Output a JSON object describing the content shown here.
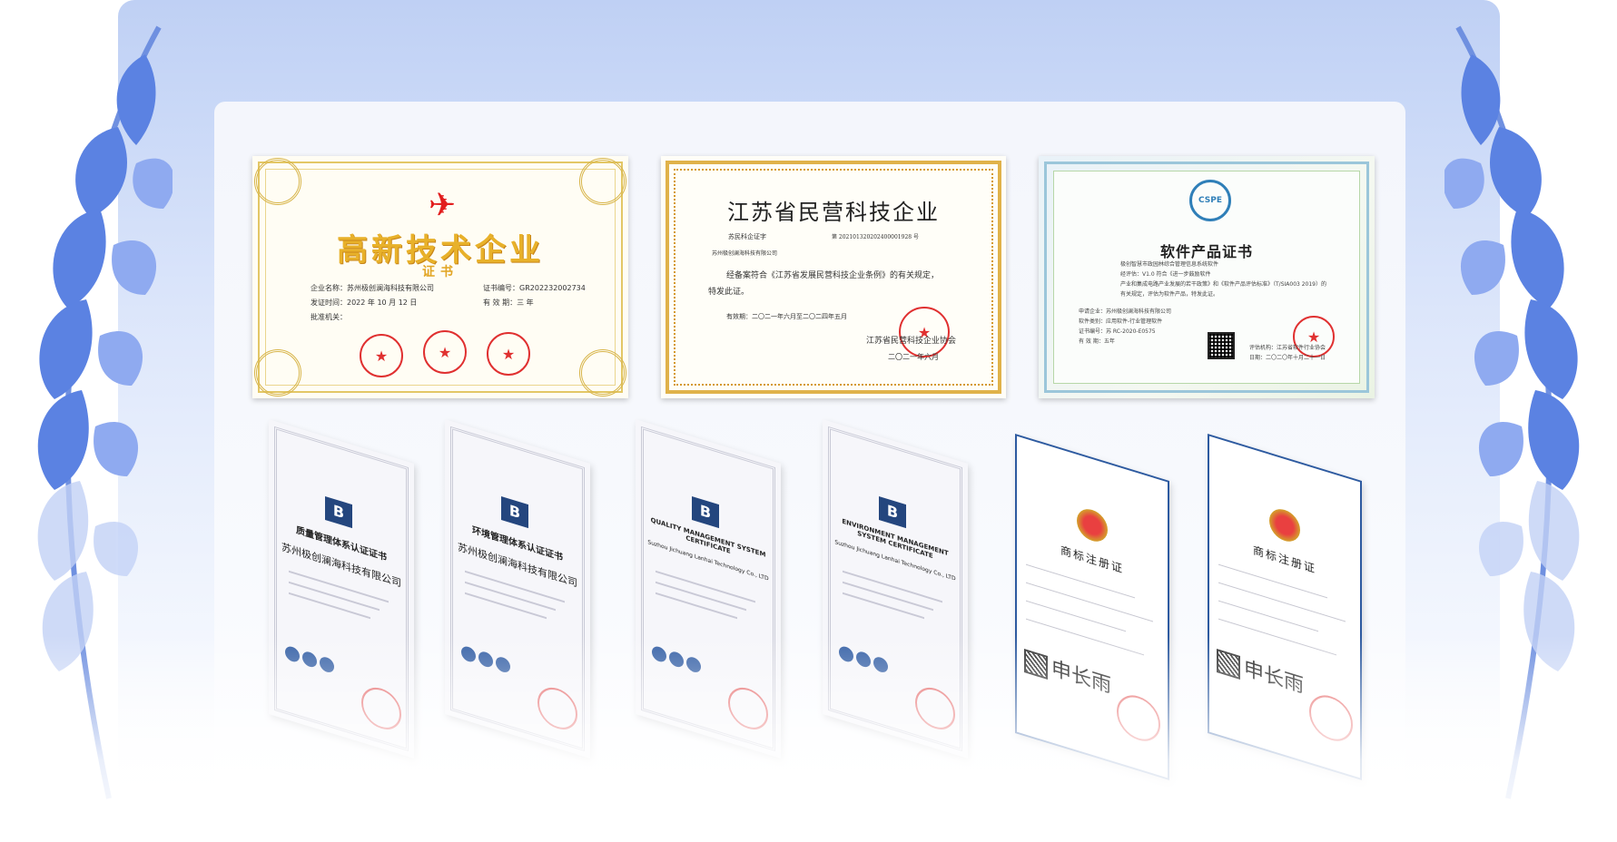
{
  "colors": {
    "accent": "#4a78d8",
    "seal_red": "#e03030",
    "gold": "#e8b12a"
  },
  "hightech": {
    "title": "高新技术企业",
    "subtitle": "证书",
    "company_label": "企业名称：",
    "company": "苏州极创澜海科技有限公司",
    "cert_no_label": "证书编号：",
    "cert_no": "GR202232002734",
    "issue_label": "发证时间：",
    "issue_date": "2022 年 10 月 12 日",
    "valid_label": "有 效 期：",
    "valid": "三 年",
    "approver_label": "批准机关："
  },
  "jiangsu": {
    "title": "江苏省民营科技企业",
    "cert_label": "苏民科企证字",
    "cert_no": "第 202101320202400001928 号",
    "company": "苏州极创澜海科技有限公司",
    "body_1": "经备案符合《江苏省发展民营科技企业条例》的有关规定，",
    "body_2": "特发此证。",
    "validity": "有效期：二〇二一年六月至二〇二四年五月",
    "issuer": "江苏省民营科技企业协会",
    "date": "二〇二一年六月"
  },
  "software": {
    "badge": "CSPE",
    "title": "软件产品证书",
    "line_1": "极创智慧市政园林综合管理信息系统软件",
    "line_2": "经评估：V1.0                符合《进一步鼓励软件",
    "line_3": "产业和集成电路产业发展的若干政策》和《软件产品评估标准》（T/SIA003 2019）的",
    "line_4": "有关规定，评估为软件产品，特发此证。",
    "applicant": "申请企业：苏州极创澜海科技有限公司",
    "category": "软件类别：应用软件-行业管理软件",
    "cert_no": "证书编号：苏 RC-2020-E0575",
    "valid": "有 效 期：五年",
    "org": "评估机构：江苏省软件行业协会",
    "date": "日期：二〇二〇年十月二十一日"
  },
  "iso_certs": [
    {
      "title": "质量管理体系认证证书",
      "company": "苏州极创澜海科技有限公司"
    },
    {
      "title": "环境管理体系认证证书",
      "company": "苏州极创澜海科技有限公司"
    },
    {
      "title": "QUALITY MANAGEMENT SYSTEM CERTIFICATE",
      "company": "Suzhou Jichuang Lanhai Technology Co., LTD"
    },
    {
      "title": "ENVIRONMENT MANAGEMENT SYSTEM CERTIFICATE",
      "company": "Suzhou Jichuang Lanhai Technology Co., LTD"
    }
  ],
  "trademarks": [
    {
      "title": "商标注册证",
      "signature": "申长雨"
    },
    {
      "title": "商标注册证",
      "signature": "申长雨"
    }
  ]
}
